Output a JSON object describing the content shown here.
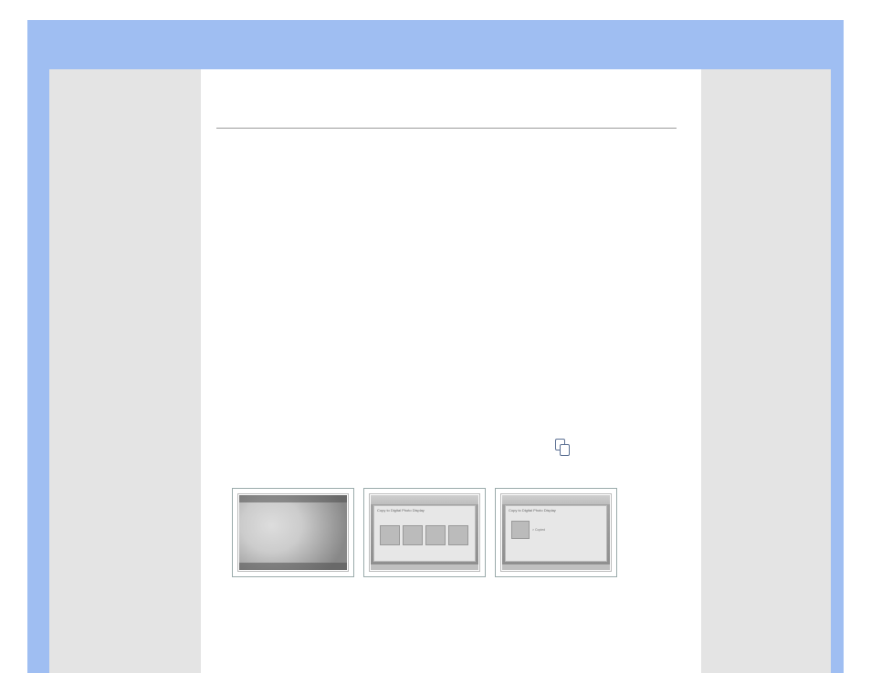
{
  "thumb1": {
    "top_left": "",
    "top_right": "",
    "bot_left": "",
    "bot_right": ""
  },
  "thumb2": {
    "header_line1": "",
    "header_line2": "",
    "dialog_title": "Copy to Digital Photo Display",
    "footer": ""
  },
  "thumb3": {
    "header_line1": "",
    "header_line2": "",
    "dialog_title": "Copy to Digital Photo Display",
    "item_label": "> Copied",
    "footer": ""
  }
}
